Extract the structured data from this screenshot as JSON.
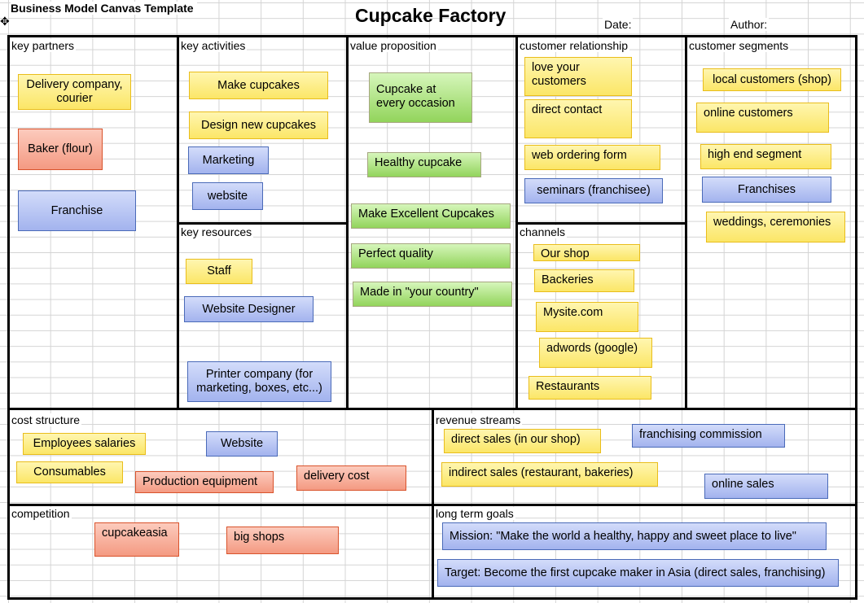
{
  "header": {
    "template_title": "Business Model Canvas Template",
    "title": "Cupcake Factory",
    "date_label": "Date:",
    "author_label": "Author:"
  },
  "sections": {
    "key_partners": {
      "label": "key partners",
      "notes": [
        {
          "text": "Delivery company, courier",
          "color": "yellow"
        },
        {
          "text": "Baker (flour)",
          "color": "red"
        },
        {
          "text": "Franchise",
          "color": "blue"
        }
      ]
    },
    "key_activities": {
      "label": "key activities",
      "notes": [
        {
          "text": "Make cupcakes",
          "color": "yellow"
        },
        {
          "text": "Design new cupcakes",
          "color": "yellow"
        },
        {
          "text": "Marketing",
          "color": "blue"
        },
        {
          "text": "website",
          "color": "blue"
        }
      ]
    },
    "key_resources": {
      "label": "key resources",
      "notes": [
        {
          "text": "Staff",
          "color": "yellow"
        },
        {
          "text": "Website Designer",
          "color": "blue"
        },
        {
          "text": "Printer company (for marketing, boxes, etc...)",
          "color": "blue"
        }
      ]
    },
    "value_proposition": {
      "label": "value proposition",
      "notes": [
        {
          "text": "Cupcake at every occasion",
          "color": "green"
        },
        {
          "text": "Healthy cupcake",
          "color": "green"
        },
        {
          "text": "Make Excellent Cupcakes",
          "color": "green"
        },
        {
          "text": "Perfect quality",
          "color": "green"
        },
        {
          "text": "Made in \"your country\"",
          "color": "green"
        }
      ]
    },
    "customer_relationship": {
      "label": "customer relationship",
      "notes": [
        {
          "text": "love your customers",
          "color": "yellow"
        },
        {
          "text": "direct contact",
          "color": "yellow"
        },
        {
          "text": "web ordering form",
          "color": "yellow"
        },
        {
          "text": "seminars (franchisee)",
          "color": "blue"
        }
      ]
    },
    "channels": {
      "label": "channels",
      "notes": [
        {
          "text": "Our shop",
          "color": "yellow"
        },
        {
          "text": "Backeries",
          "color": "yellow"
        },
        {
          "text": "Mysite.com",
          "color": "yellow"
        },
        {
          "text": "adwords (google)",
          "color": "yellow"
        },
        {
          "text": "Restaurants",
          "color": "yellow"
        }
      ]
    },
    "customer_segments": {
      "label": "customer segments",
      "notes": [
        {
          "text": "local customers (shop)",
          "color": "yellow"
        },
        {
          "text": "online customers",
          "color": "yellow"
        },
        {
          "text": "high end segment",
          "color": "yellow"
        },
        {
          "text": "Franchises",
          "color": "blue"
        },
        {
          "text": "weddings, ceremonies",
          "color": "yellow"
        }
      ]
    },
    "cost_structure": {
      "label": "cost structure",
      "notes": [
        {
          "text": "Employees salaries",
          "color": "yellow"
        },
        {
          "text": "Website",
          "color": "blue"
        },
        {
          "text": "Consumables",
          "color": "yellow"
        },
        {
          "text": "Production equipment",
          "color": "red"
        },
        {
          "text": "delivery cost",
          "color": "red"
        }
      ]
    },
    "revenue_streams": {
      "label": "revenue streams",
      "notes": [
        {
          "text": "direct sales (in our shop)",
          "color": "yellow"
        },
        {
          "text": "franchising commission",
          "color": "blue"
        },
        {
          "text": "indirect sales (restaurant, bakeries)",
          "color": "yellow"
        },
        {
          "text": "online sales",
          "color": "blue"
        }
      ]
    },
    "competition": {
      "label": "competition",
      "notes": [
        {
          "text": "cupcakeasia",
          "color": "red"
        },
        {
          "text": "big shops",
          "color": "red"
        }
      ]
    },
    "long_term_goals": {
      "label": "long term goals",
      "notes": [
        {
          "text": "Mission: \"Make the world a healthy, happy and sweet place to live\"",
          "color": "blue"
        },
        {
          "text": "Target: Become the first cupcake maker in Asia (direct sales, franchising)",
          "color": "blue"
        }
      ]
    }
  },
  "colors": {
    "yellow": "#fbe667",
    "blue": "#a3b3ee",
    "red": "#f49a82",
    "green": "#92d45b",
    "border": "#000000",
    "grid": "#d4d4d4"
  }
}
